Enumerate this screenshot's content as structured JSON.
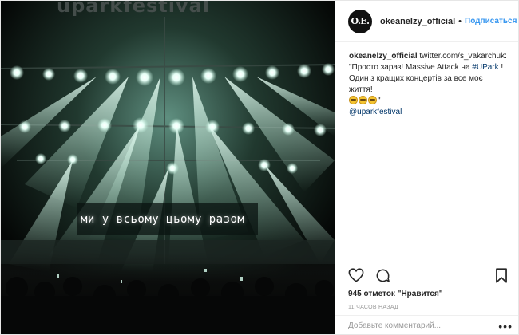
{
  "photo": {
    "banner_text": "uparkfestival",
    "screen_text": "ми у всьому цьому разом"
  },
  "header": {
    "avatar_text": "O.E.",
    "username": "okeanelzy_official",
    "separator": "•",
    "follow_label": "Подписаться"
  },
  "caption": {
    "username": "okeanelzy_official",
    "link": "twitter.com/s_vakarchuk",
    "text_before_tag": ": \"Просто зараз! Massive Attack на ",
    "hashtag": "#UPark",
    "text_after_tag": " ! Один з кращих концертів за все моє життя!",
    "quote_end": "\"",
    "emoji": [
      "grimacing-face",
      "grimacing-face",
      "grimacing-face"
    ],
    "mention": "@uparkfestival"
  },
  "actions": {
    "icons": [
      "heart-icon",
      "comment-icon",
      "bookmark-icon"
    ],
    "likes": "945 отметок \"Нравится\"",
    "time": "11 ЧАСОВ НАЗАД"
  },
  "comment": {
    "placeholder": "Добавьте комментарий...",
    "more_label": "•••"
  },
  "colors": {
    "link": "#003569",
    "follow": "#3897f0",
    "stage_light": "#cfeee0"
  }
}
